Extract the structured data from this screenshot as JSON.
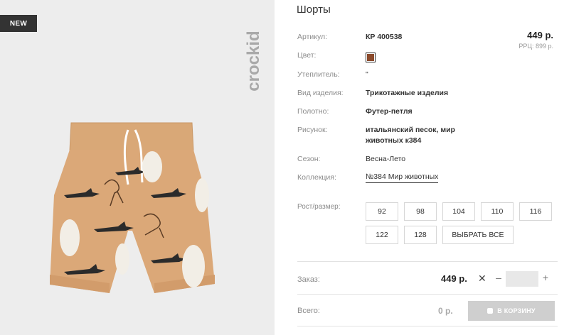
{
  "badge": "NEW",
  "brand": "crockid",
  "product": {
    "title": "Шорты",
    "price": "449 р.",
    "rrp": "РРЦ: 899 р."
  },
  "attributes": {
    "article_label": "Артикул:",
    "article_value": "КР 400538",
    "color_label": "Цвет:",
    "color_hex": "#8b4a2b",
    "insulation_label": "Утеплитель:",
    "insulation_value": "\"",
    "type_label": "Вид изделия:",
    "type_value": "Трикотажные изделия",
    "fabric_label": "Полотно:",
    "fabric_value": "Футер-петля",
    "pattern_label": "Рисунок:",
    "pattern_value_1": "итальянский песок, мир",
    "pattern_value_2": "животных к384",
    "season_label": "Сезон:",
    "season_value": "Весна-Лето",
    "collection_label": "Коллекция:",
    "collection_value": "№384 Мир животных"
  },
  "sizes": {
    "label": "Рост/размер:",
    "options": [
      "92",
      "98",
      "104",
      "110",
      "116",
      "122",
      "128"
    ],
    "select_all": "ВЫБРАТЬ ВСЕ"
  },
  "order": {
    "label": "Заказ:",
    "price": "449 р.",
    "remove": "✕",
    "minus": "–",
    "plus": "+",
    "quantity": ""
  },
  "total": {
    "label": "Всего:",
    "sum": "0 р.",
    "cart_button": "В КОРЗИНУ"
  }
}
